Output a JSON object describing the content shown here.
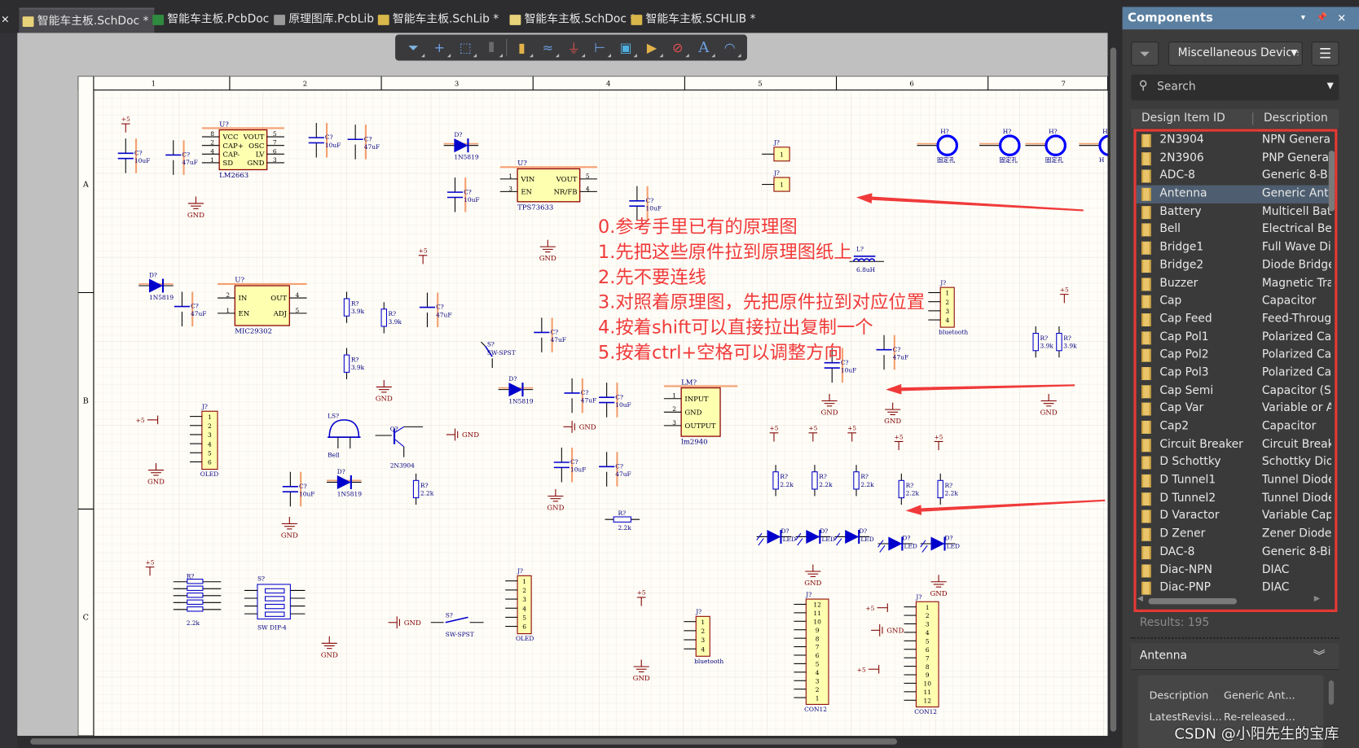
{
  "tabs": [
    {
      "label": "智能车主板.SchDoc *",
      "icon": "schdoc-icon",
      "active": true
    },
    {
      "label": "智能车主板.PcbDoc",
      "icon": "pcbdoc-icon"
    },
    {
      "label": "原理图库.PcbLib",
      "icon": "pcblib-icon"
    },
    {
      "label": "智能车主板.SchLib *",
      "icon": "schlib-icon"
    },
    {
      "label": "智能车主板.SchDoc *",
      "icon": "schdoc-icon"
    },
    {
      "label": "智能车主板.SCHLIB *",
      "icon": "schlib-icon"
    }
  ],
  "close_glyph": "×",
  "toolbar": [
    "filter-icon",
    "cross-icon",
    "rect-select-icon",
    "align-icon",
    "place-part-icon",
    "bus-icon",
    "gnd-power-icon",
    "bus-entry-icon",
    "harness-icon",
    "net-label-icon",
    "no-erc-icon",
    "text-icon",
    "arc-icon"
  ],
  "sheet": {
    "columns": [
      "1",
      "2",
      "3",
      "4",
      "5",
      "6",
      "7"
    ],
    "rows": [
      "A",
      "B",
      "C"
    ]
  },
  "schematic": {
    "ics": [
      {
        "ref": "U?",
        "value": "LM2663",
        "left": [
          "VCC",
          "CAP+",
          "CAP-",
          "SD"
        ],
        "right": [
          "VOUT",
          "OSC",
          "LV",
          "GND"
        ],
        "lpins": [
          "8",
          "2",
          "4",
          "1"
        ],
        "rpins": [
          "5",
          "7",
          "6",
          "3"
        ]
      },
      {
        "ref": "U?",
        "value": "TPS73633",
        "left": [
          "VIN",
          "EN"
        ],
        "right": [
          "VOUT",
          "NR/FB"
        ],
        "lpins": [
          "1",
          "3"
        ],
        "rpins": [
          "5",
          "4"
        ]
      },
      {
        "ref": "U?",
        "value": "MIC29302",
        "left": [
          "IN",
          "EN"
        ],
        "right": [
          "OUT",
          "ADJ"
        ],
        "lpins": [
          "2",
          "1"
        ],
        "rpins": [
          "4",
          "5"
        ]
      },
      {
        "ref": "LM?",
        "value": "lm2940",
        "left": [
          "INPUT",
          "GND",
          "OUTPUT"
        ],
        "right": [],
        "lpins": [
          "1",
          "2",
          "3"
        ],
        "rpins": []
      }
    ],
    "connectors": [
      {
        "ref": "J?",
        "value": "",
        "pins": [
          "1"
        ]
      },
      {
        "ref": "J?",
        "value": "",
        "pins": [
          "1"
        ]
      },
      {
        "ref": "J?",
        "value": "bluetooth",
        "pins": [
          "1",
          "2",
          "3",
          "4"
        ]
      },
      {
        "ref": "J?",
        "value": "OLED",
        "pins": [
          "1",
          "2",
          "3",
          "4",
          "5",
          "6"
        ]
      },
      {
        "ref": "J?",
        "value": "OLED",
        "pins": [
          "1",
          "2",
          "3",
          "4",
          "5",
          "6"
        ]
      },
      {
        "ref": "J?",
        "value": "bluetooth",
        "pins": [
          "1",
          "2",
          "3",
          "4"
        ]
      },
      {
        "ref": "J?",
        "value": "CON12",
        "pins": [
          "12",
          "11",
          "10",
          "9",
          "8",
          "7",
          "6",
          "5",
          "4",
          "3",
          "2",
          "1"
        ]
      },
      {
        "ref": "J?",
        "value": "CON12",
        "pins": [
          "1",
          "2",
          "3",
          "4",
          "5",
          "6",
          "7",
          "8",
          "9",
          "10",
          "11",
          "12"
        ]
      }
    ],
    "capacitors": [
      {
        "ref": "C?",
        "value": "10uF"
      },
      {
        "ref": "C?",
        "value": "47uF"
      },
      {
        "ref": "C?",
        "value": "10uF"
      },
      {
        "ref": "C?",
        "value": "47uF"
      },
      {
        "ref": "C?",
        "value": "10uF"
      },
      {
        "ref": "C?",
        "value": "10uF"
      },
      {
        "ref": "C?",
        "value": "47uF"
      },
      {
        "ref": "C?",
        "value": "47uF"
      },
      {
        "ref": "C?",
        "value": "47uF"
      },
      {
        "ref": "C?",
        "value": "47uF"
      },
      {
        "ref": "C?",
        "value": "10uF"
      },
      {
        "ref": "C?",
        "value": "47uF"
      },
      {
        "ref": "C?",
        "value": "10uF"
      },
      {
        "ref": "C?",
        "value": "10uF"
      },
      {
        "ref": "C?",
        "value": "10uF"
      },
      {
        "ref": "C?",
        "value": "47uF"
      }
    ],
    "resistors": [
      {
        "ref": "R?",
        "value": "3.9k"
      },
      {
        "ref": "R?",
        "value": "3.9k"
      },
      {
        "ref": "R?",
        "value": "3.9k"
      },
      {
        "ref": "R?",
        "value": "2.2k"
      },
      {
        "ref": "R?",
        "value": "2.2k"
      },
      {
        "ref": "R?",
        "value": "2.2k"
      },
      {
        "ref": "R?",
        "value": "2.2k"
      },
      {
        "ref": "R?",
        "value": "2.2k"
      },
      {
        "ref": "R?",
        "value": "2.2k"
      },
      {
        "ref": "R?",
        "value": "3.9k"
      },
      {
        "ref": "R?",
        "value": "3.9k"
      },
      {
        "ref": "R?",
        "value": "2.2k"
      }
    ],
    "diodes": [
      {
        "ref": "D?",
        "value": "1N5819"
      },
      {
        "ref": "D?",
        "value": "1N5819"
      },
      {
        "ref": "D?",
        "value": "1N5819"
      },
      {
        "ref": "D?",
        "value": "1N5819"
      }
    ],
    "leds": [
      {
        "ref": "D?",
        "value": "LED"
      },
      {
        "ref": "D?",
        "value": "LED"
      },
      {
        "ref": "D?",
        "value": "LED"
      },
      {
        "ref": "D?",
        "value": "LED"
      },
      {
        "ref": "D?",
        "value": "LED"
      }
    ],
    "gnd_label": "GND",
    "power_label": "+5",
    "holes": [
      {
        "ref": "H?",
        "value": "固定孔"
      },
      {
        "ref": "H?",
        "value": "固定孔"
      },
      {
        "ref": "H?",
        "value": "固定孔"
      },
      {
        "ref": "H?",
        "value": "H"
      }
    ],
    "misc": [
      {
        "kind": "bell",
        "ref": "LS?",
        "value": "Bell"
      },
      {
        "kind": "npn",
        "ref": "Q?",
        "value": "2N3904"
      },
      {
        "kind": "switch",
        "ref": "S?",
        "value": "SW-SPST"
      },
      {
        "kind": "switch",
        "ref": "S?",
        "value": "SW-SPST"
      },
      {
        "kind": "dip",
        "ref": "S?",
        "value": "SW DIP-4"
      },
      {
        "kind": "inductor",
        "ref": "L?",
        "value": "6.8uH"
      },
      {
        "kind": "rpack",
        "ref": "R?",
        "value": "2.2k"
      }
    ]
  },
  "annotations": [
    "0.参考手里已有的原理图",
    "1.先把这些原件拉到原理图纸上",
    "2.先不要连线",
    "3.对照着原理图，先把原件拉到对应位置",
    "4.按着shift可以直接拉出复制一个",
    "5.按着ctrl+空格可以调整方向"
  ],
  "annotation_color": "#f03a3a",
  "components_panel": {
    "title": "Components",
    "library": "Miscellaneous Device",
    "search_placeholder": "Search",
    "columns": [
      "Design Item ID",
      "Description"
    ],
    "items": [
      {
        "id": "2N3904",
        "desc": "NPN General"
      },
      {
        "id": "2N3906",
        "desc": "PNP General"
      },
      {
        "id": "ADC-8",
        "desc": "Generic 8-Bit"
      },
      {
        "id": "Antenna",
        "desc": "Generic Antenna",
        "selected": true
      },
      {
        "id": "Battery",
        "desc": "Multicell Batt"
      },
      {
        "id": "Bell",
        "desc": "Electrical Bell"
      },
      {
        "id": "Bridge1",
        "desc": "Full Wave Dio"
      },
      {
        "id": "Bridge2",
        "desc": "Diode Bridge"
      },
      {
        "id": "Buzzer",
        "desc": "Magnetic Tra"
      },
      {
        "id": "Cap",
        "desc": "Capacitor"
      },
      {
        "id": "Cap Feed",
        "desc": "Feed-Through"
      },
      {
        "id": "Cap Pol1",
        "desc": "Polarized Cap"
      },
      {
        "id": "Cap Pol2",
        "desc": "Polarized Cap"
      },
      {
        "id": "Cap Pol3",
        "desc": "Polarized Cap"
      },
      {
        "id": "Cap Semi",
        "desc": "Capacitor (Se"
      },
      {
        "id": "Cap Var",
        "desc": "Variable or A"
      },
      {
        "id": "Cap2",
        "desc": "Capacitor"
      },
      {
        "id": "Circuit Breaker",
        "desc": "Circuit Break"
      },
      {
        "id": "D Schottky",
        "desc": "Schottky Dio"
      },
      {
        "id": "D Tunnel1",
        "desc": "Tunnel Diode"
      },
      {
        "id": "D Tunnel2",
        "desc": "Tunnel Diode"
      },
      {
        "id": "D Varactor",
        "desc": "Variable Cap"
      },
      {
        "id": "D Zener",
        "desc": "Zener Diode"
      },
      {
        "id": "DAC-8",
        "desc": "Generic 8-Bit"
      },
      {
        "id": "Diac-NPN",
        "desc": "DIAC"
      },
      {
        "id": "Diac-PNP",
        "desc": "DIAC"
      }
    ],
    "results": "Results: 195",
    "detail_title": "Antenna",
    "details": [
      {
        "label": "Description",
        "value": "Generic Ant..."
      },
      {
        "label": "LatestRevisi...",
        "value": "Re-released..."
      }
    ],
    "accent": "#5b7fa0",
    "highlight": "#e53935"
  },
  "watermark": "CSDN @小阳先生的宝库"
}
